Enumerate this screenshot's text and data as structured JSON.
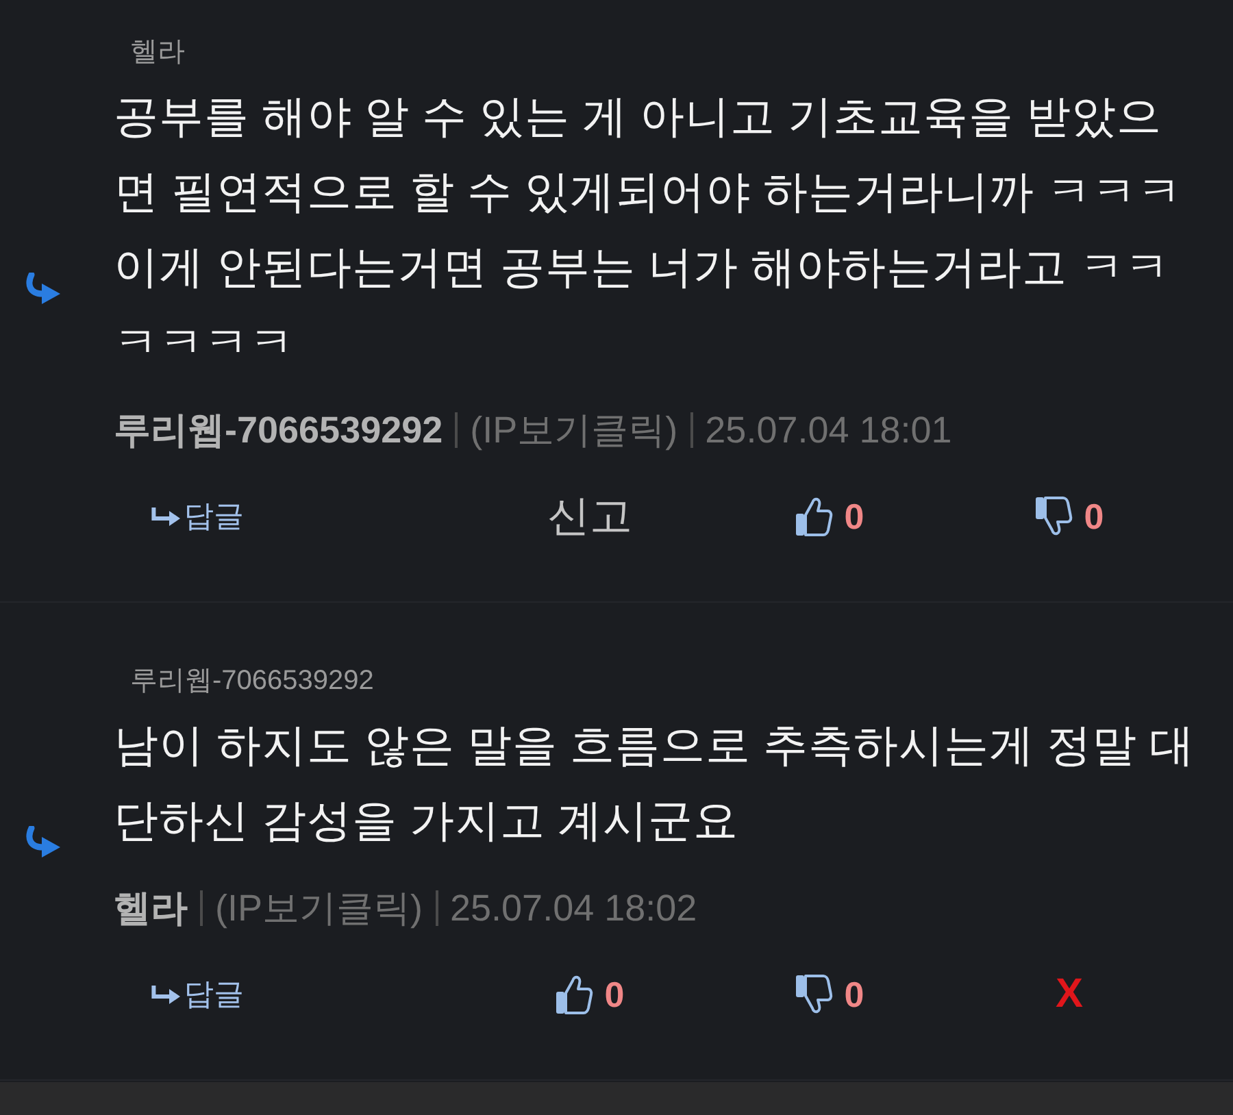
{
  "comments": [
    {
      "reply_to": "헬라",
      "body": "공부를 해야 알 수 있는 게 아니고 기초교육을 받았으면 필연적으로 할 수 있게되어야 하는거라니까 ㅋㅋㅋ 이게 안된다는거면 공부는 너가 해야하는거라고 ㅋㅋㅋㅋㅋㅋ",
      "author": "루리웹-7066539292",
      "ip_link": "(IP보기클릭)",
      "time": "25.07.04 18:01",
      "actions": [
        {
          "kind": "reply",
          "label": "답글"
        },
        {
          "kind": "report",
          "label": "신고"
        },
        {
          "kind": "like",
          "count": "0"
        },
        {
          "kind": "dislike",
          "count": "0"
        }
      ]
    },
    {
      "reply_to": "루리웹-7066539292",
      "body": "남이 하지도 않은 말을 흐름으로 추측하시는게 정말 대단하신 감성을 가지고 계시군요",
      "author": "헬라",
      "ip_link": "(IP보기클릭)",
      "time": "25.07.04 18:02",
      "actions": [
        {
          "kind": "reply",
          "label": "답글"
        },
        {
          "kind": "like",
          "count": "0"
        },
        {
          "kind": "dislike",
          "count": "0"
        },
        {
          "kind": "delete",
          "label": "X"
        }
      ]
    }
  ]
}
